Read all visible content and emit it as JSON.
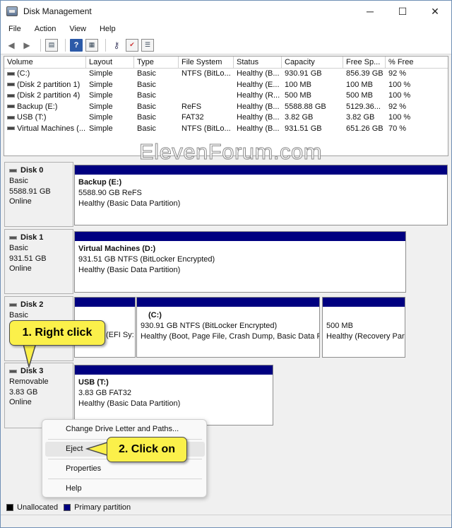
{
  "window": {
    "title": "Disk Management",
    "min": "─",
    "max": "☐",
    "close": "✕"
  },
  "menu": [
    "File",
    "Action",
    "View",
    "Help"
  ],
  "toolbar": {
    "icons": [
      "back-arrow-icon",
      "forward-arrow-icon",
      "properties-icon",
      "help-icon",
      "rescan-icon",
      "check-icon",
      "settings-icon"
    ]
  },
  "columns": [
    "Volume",
    "Layout",
    "Type",
    "File System",
    "Status",
    "Capacity",
    "Free Sp...",
    "% Free"
  ],
  "volumes": [
    [
      "(C:)",
      "Simple",
      "Basic",
      "NTFS (BitLo...",
      "Healthy (B...",
      "930.91 GB",
      "856.39 GB",
      "92 %"
    ],
    [
      "(Disk 2 partition 1)",
      "Simple",
      "Basic",
      "",
      "Healthy (E...",
      "100 MB",
      "100 MB",
      "100 %"
    ],
    [
      "(Disk 2 partition 4)",
      "Simple",
      "Basic",
      "",
      "Healthy (R...",
      "500 MB",
      "500 MB",
      "100 %"
    ],
    [
      "Backup (E:)",
      "Simple",
      "Basic",
      "ReFS",
      "Healthy (B...",
      "5588.88 GB",
      "5129.36...",
      "92 %"
    ],
    [
      "USB (T:)",
      "Simple",
      "Basic",
      "FAT32",
      "Healthy (B...",
      "3.82 GB",
      "3.82 GB",
      "100 %"
    ],
    [
      "Virtual Machines (...",
      "Simple",
      "Basic",
      "NTFS (BitLo...",
      "Healthy (B...",
      "931.51 GB",
      "651.26 GB",
      "70 %"
    ]
  ],
  "disks": [
    {
      "name": "Disk 0",
      "type": "Basic",
      "size": "5588.91 GB",
      "state": "Online",
      "partitions": [
        {
          "name": "Backup  (E:)",
          "line1": "5588.90 GB ReFS",
          "line2": "Healthy (Basic Data Partition)"
        }
      ]
    },
    {
      "name": "Disk 1",
      "type": "Basic",
      "size": "931.51 GB",
      "state": "Online",
      "partitions": [
        {
          "name": "Virtual Machines  (D:)",
          "line1": "931.51 GB NTFS (BitLocker Encrypted)",
          "line2": "Healthy (Basic Data Partition)"
        }
      ]
    },
    {
      "name": "Disk 2",
      "type": "Basic",
      "partitions": [
        {
          "line2": "(EFI Sy:"
        },
        {
          "name": "(C:)",
          "line1": "930.91 GB NTFS (BitLocker Encrypted)",
          "line2": "Healthy (Boot, Page File, Crash Dump, Basic Data Pa"
        },
        {
          "line1": "500 MB",
          "line2": "Healthy (Recovery Par"
        }
      ]
    },
    {
      "name": "Disk 3",
      "type": "Removable",
      "size": "3.83 GB",
      "state": "Online",
      "partitions": [
        {
          "name": "USB  (T:)",
          "line1": "3.83 GB FAT32",
          "line2": "Healthy (Basic Data Partition)"
        }
      ]
    }
  ],
  "context_menu": [
    "Change Drive Letter and Paths...",
    "Eject",
    "Properties",
    "Help"
  ],
  "legend": {
    "unallocated": "Unallocated",
    "primary": "Primary partition",
    "unallocated_color": "#000000",
    "primary_color": "#000080"
  },
  "callouts": {
    "step1": "1. Right click",
    "step2": "2. Click on"
  },
  "watermark": "ElevenForum.com"
}
